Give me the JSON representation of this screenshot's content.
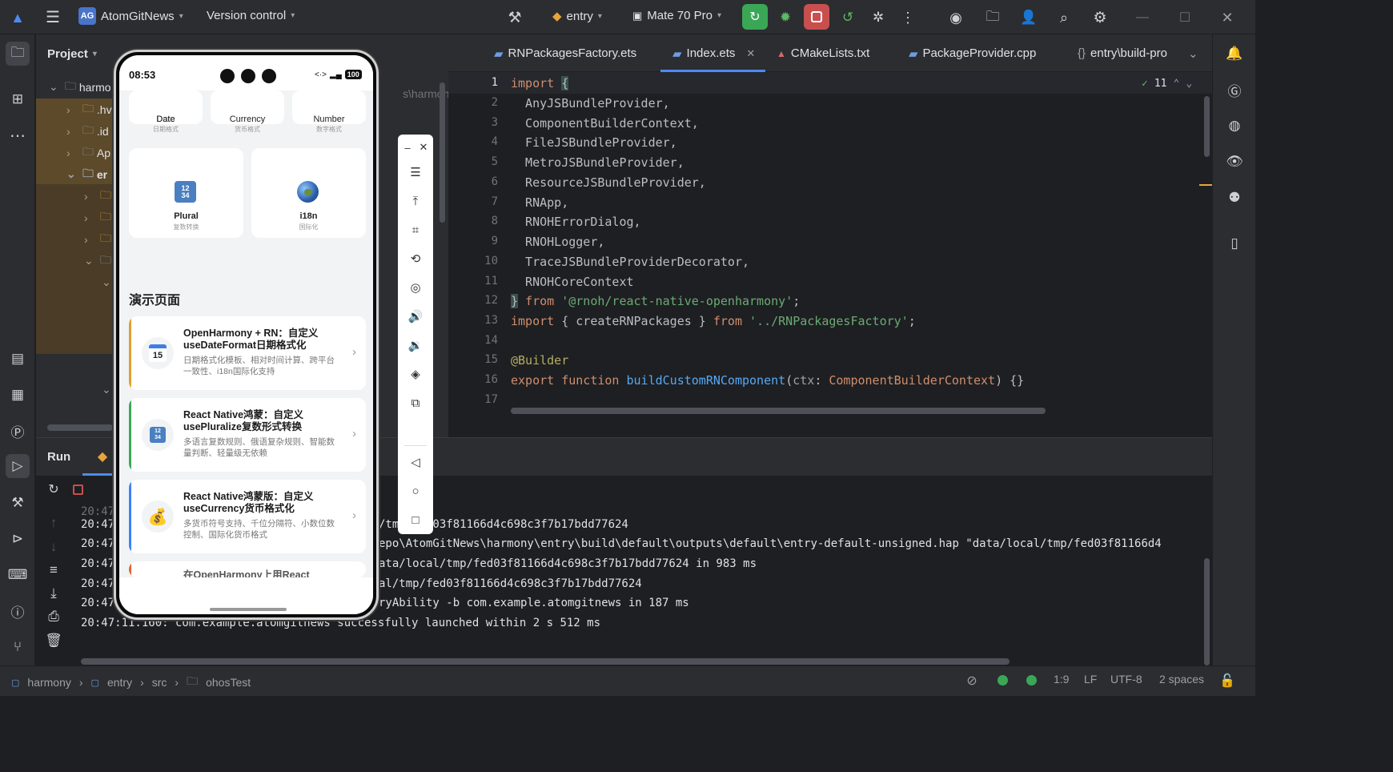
{
  "titlebar": {
    "project_name": "AtomGitNews",
    "project_badge": "AG",
    "vcs_label": "Version control",
    "run_config": "entry",
    "device": "Mate 70 Pro"
  },
  "project_panel": {
    "title": "Project",
    "tree": [
      "harmo",
      ".hv",
      ".id",
      "Ap",
      "er"
    ]
  },
  "editor": {
    "tabs": [
      "RNPackagesFactory.ets",
      "Index.ets",
      "CMakeLists.txt",
      "PackageProvider.cpp",
      "entry\\build-pro"
    ],
    "active_tab": "Index.ets",
    "inspection_count": "11",
    "line_numbers": [
      "1",
      "2",
      "3",
      "4",
      "5",
      "6",
      "7",
      "8",
      "9",
      "10",
      "11",
      "12",
      "13",
      "14",
      "15",
      "16",
      "17"
    ],
    "path_hint": "s\\harmony"
  },
  "run_panel": {
    "title": "Run",
    "log": [
      "20:47",
      "20:47",
      "20:47",
      "20:47",
      "20:47",
      "20:47",
      "20:47:11.160: com.example.atomgitnews successfully launched within 2 s 512 ms"
    ],
    "log_tails": [
      "/tmp/fed03f81166d4c698c3f7b17bdd77624",
      "epo\\AtomGitNews\\harmony\\entry\\build\\default\\outputs\\default\\entry-default-unsigned.hap \"data/local/tmp/fed03f81166d4",
      "ata/local/tmp/fed03f81166d4c698c3f7b17bdd77624 in 983 ms",
      "al/tmp/fed03f81166d4c698c3f7b17bdd77624",
      "ryAbility -b com.example.atomgitnews in 187 ms"
    ]
  },
  "statusbar": {
    "crumbs": [
      "harmony",
      "entry",
      "src",
      "ohosTest"
    ],
    "position": "1:9",
    "line_sep": "LF",
    "encoding": "UTF-8",
    "indent": "2 spaces"
  },
  "phone": {
    "time": "08:53",
    "battery": "100",
    "top_cards": [
      {
        "title": "Date",
        "sub": "日期格式"
      },
      {
        "title": "Currency",
        "sub": "货币格式"
      },
      {
        "title": "Number",
        "sub": "数字格式"
      }
    ],
    "big_cards": [
      {
        "title": "Plural",
        "sub": "复数转换",
        "icon": "12\n34"
      },
      {
        "title": "i18n",
        "sub": "国际化",
        "icon": "globe"
      }
    ],
    "section_title": "演示页面",
    "demos": [
      {
        "title": "OpenHarmony + RN：自定义useDateFormat日期格式化",
        "desc": "日期格式化模板、相对时间计算、跨平台一致性、i18n国际化支持",
        "color": "#e0a030",
        "icon": "15"
      },
      {
        "title": "React Native鸿蒙：自定义usePluralize复数形式转换",
        "desc": "多语言复数规则、俄语复杂规则、智能数量判断、轻量级无依赖",
        "color": "#3aa757",
        "icon": "12 34"
      },
      {
        "title": "React Native鸿蒙版：自定义useCurrency货币格式化",
        "desc": "多货币符号支持、千位分隔符、小数位数控制、国际化货币格式",
        "color": "#3b82f6",
        "icon": "$"
      },
      {
        "title": "在OpenHarmony上用React",
        "desc": "",
        "color": "#e0622f",
        "icon": ""
      }
    ]
  },
  "colors": {
    "ide_bg": "#1e1f22",
    "panel_bg": "#2b2d30",
    "accent_green": "#3aa757",
    "stop_red": "#c94f4f"
  }
}
